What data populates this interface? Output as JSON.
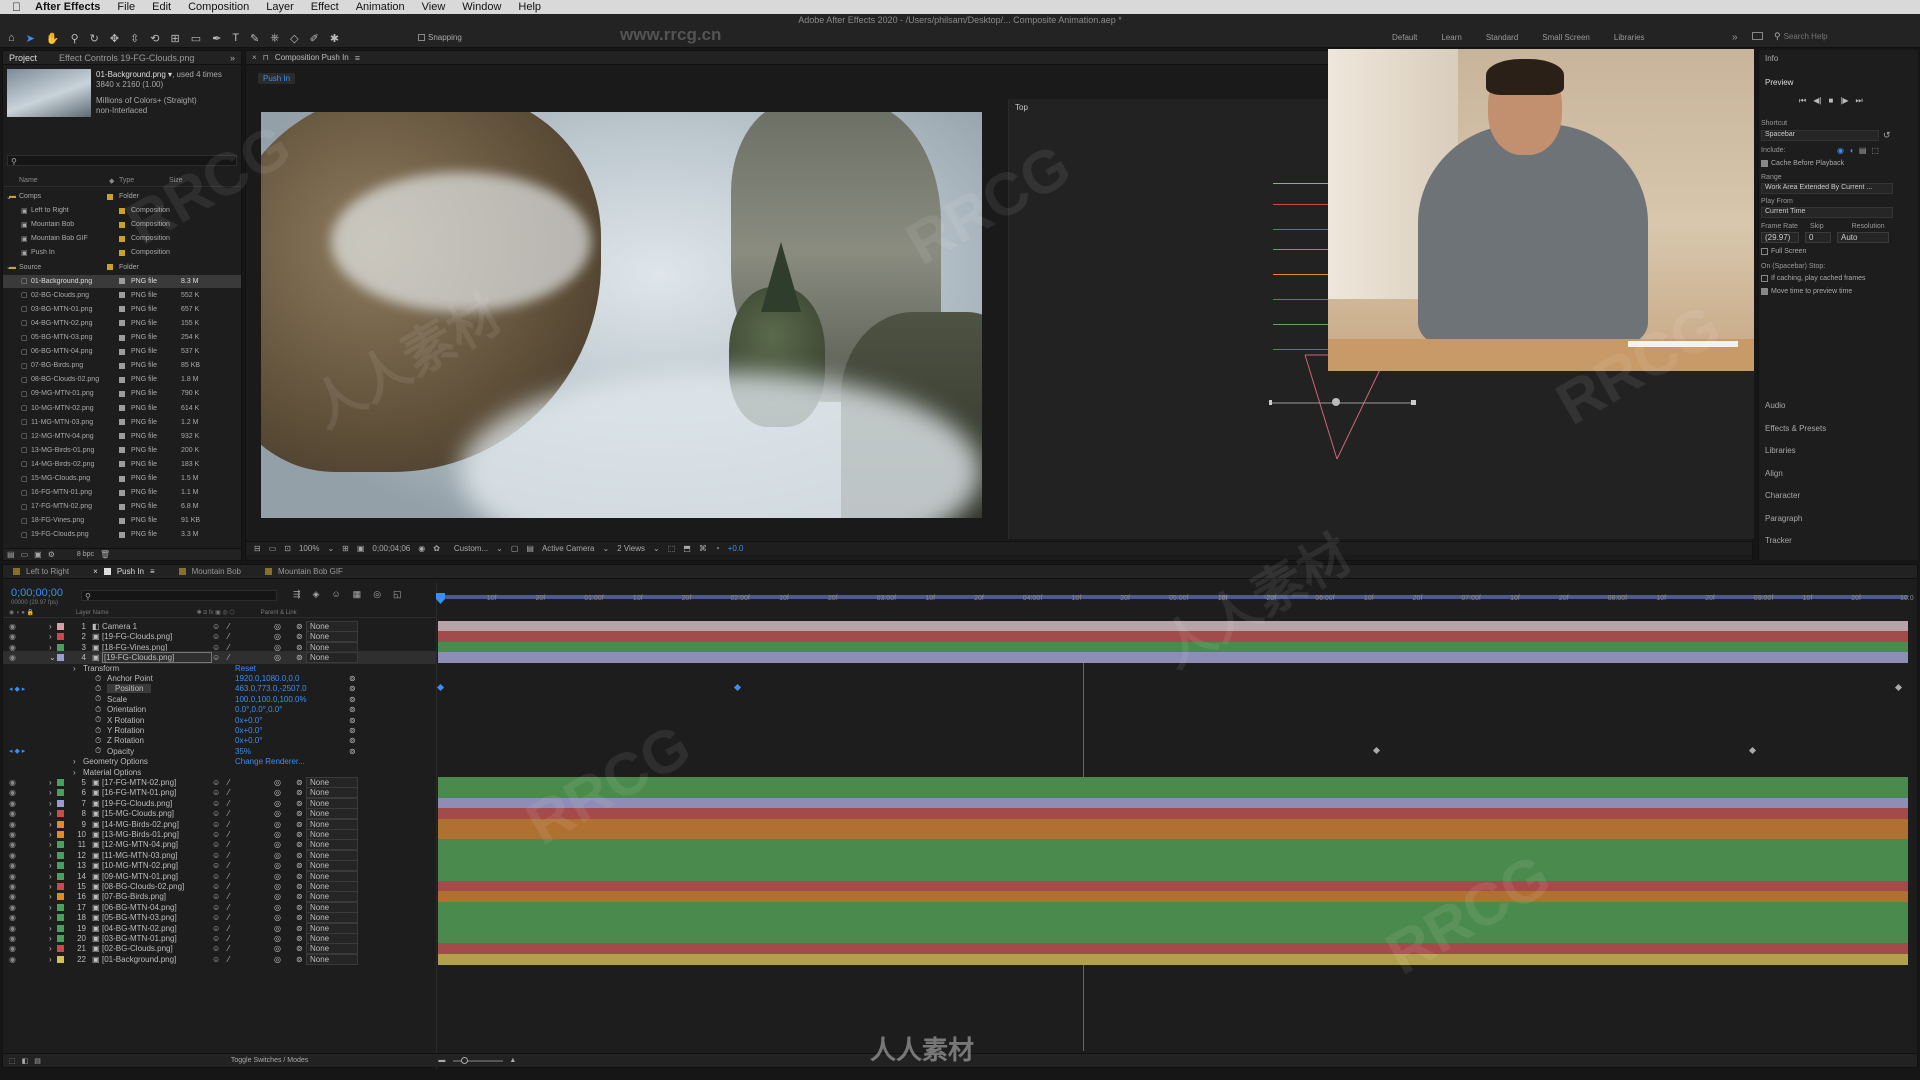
{
  "menubar": {
    "items": [
      "After Effects",
      "File",
      "Edit",
      "Composition",
      "Layer",
      "Effect",
      "Animation",
      "View",
      "Window",
      "Help"
    ]
  },
  "window": {
    "title": "Adobe After Effects 2020 - /Users/philsam/Desktop/... Composite Animation.aep *"
  },
  "toolbar": {
    "snapping": "Snapping",
    "workspaces": [
      "Default",
      "Learn",
      "Standard",
      "Small Screen",
      "Libraries"
    ],
    "search_placeholder": "Search Help",
    "url_watermark": "www.rrcg.cn"
  },
  "project": {
    "tab_project": "Project",
    "tab_effects": "Effect Controls 19-FG-Clouds.png",
    "asset_name": "01-Background.png ▾",
    "asset_used": ", used 4 times",
    "asset_dims": "3840 x 2160 (1.00)",
    "asset_colors": "Millions of Colors+ (Straight)",
    "asset_interlace": "non-Interlaced",
    "col_name": "Name",
    "col_type": "Type",
    "col_size": "Size",
    "bpc": "8 bpc",
    "items": [
      {
        "name": "Comps",
        "type": "Folder",
        "size": "",
        "indent": 0,
        "color": "#c9a227",
        "folder": true
      },
      {
        "name": "Left to Right",
        "type": "Composition",
        "size": "",
        "indent": 1,
        "color": "#c9a227"
      },
      {
        "name": "Mountain Bob",
        "type": "Composition",
        "size": "",
        "indent": 1,
        "color": "#c9a227"
      },
      {
        "name": "Mountain Bob GIF",
        "type": "Composition",
        "size": "",
        "indent": 1,
        "color": "#c9a227"
      },
      {
        "name": "Push In",
        "type": "Composition",
        "size": "",
        "indent": 1,
        "color": "#c9a227"
      },
      {
        "name": "Source",
        "type": "Folder",
        "size": "",
        "indent": 0,
        "color": "#c9a227",
        "folder": true
      },
      {
        "name": "01-Background.png",
        "type": "PNG file",
        "size": "8.3 M",
        "indent": 1,
        "color": "#9c9c9c",
        "sel": true
      },
      {
        "name": "02-BG-Clouds.png",
        "type": "PNG file",
        "size": "552 K",
        "indent": 1,
        "color": "#9c9c9c"
      },
      {
        "name": "03-BG-MTN-01.png",
        "type": "PNG file",
        "size": "657 K",
        "indent": 1,
        "color": "#9c9c9c"
      },
      {
        "name": "04-BG-MTN-02.png",
        "type": "PNG file",
        "size": "155 K",
        "indent": 1,
        "color": "#9c9c9c"
      },
      {
        "name": "05-BG-MTN-03.png",
        "type": "PNG file",
        "size": "254 K",
        "indent": 1,
        "color": "#9c9c9c"
      },
      {
        "name": "06-BG-MTN-04.png",
        "type": "PNG file",
        "size": "537 K",
        "indent": 1,
        "color": "#9c9c9c"
      },
      {
        "name": "07-BG-Birds.png",
        "type": "PNG file",
        "size": "85 KB",
        "indent": 1,
        "color": "#9c9c9c"
      },
      {
        "name": "08-BG-Clouds-02.png",
        "type": "PNG file",
        "size": "1.8 M",
        "indent": 1,
        "color": "#9c9c9c"
      },
      {
        "name": "09-MG-MTN-01.png",
        "type": "PNG file",
        "size": "790 K",
        "indent": 1,
        "color": "#9c9c9c"
      },
      {
        "name": "10-MG-MTN-02.png",
        "type": "PNG file",
        "size": "614 K",
        "indent": 1,
        "color": "#9c9c9c"
      },
      {
        "name": "11-MG-MTN-03.png",
        "type": "PNG file",
        "size": "1.2 M",
        "indent": 1,
        "color": "#9c9c9c"
      },
      {
        "name": "12-MG-MTN-04.png",
        "type": "PNG file",
        "size": "932 K",
        "indent": 1,
        "color": "#9c9c9c"
      },
      {
        "name": "13-MG-Birds-01.png",
        "type": "PNG file",
        "size": "200 K",
        "indent": 1,
        "color": "#9c9c9c"
      },
      {
        "name": "14-MG-Birds-02.png",
        "type": "PNG file",
        "size": "183 K",
        "indent": 1,
        "color": "#9c9c9c"
      },
      {
        "name": "15-MG-Clouds.png",
        "type": "PNG file",
        "size": "1.5 M",
        "indent": 1,
        "color": "#9c9c9c"
      },
      {
        "name": "16-FG-MTN-01.png",
        "type": "PNG file",
        "size": "1.1 M",
        "indent": 1,
        "color": "#9c9c9c"
      },
      {
        "name": "17-FG-MTN-02.png",
        "type": "PNG file",
        "size": "6.8 M",
        "indent": 1,
        "color": "#9c9c9c"
      },
      {
        "name": "18-FG-Vines.png",
        "type": "PNG file",
        "size": "91 KB",
        "indent": 1,
        "color": "#9c9c9c"
      },
      {
        "name": "19-FG-Clouds.png",
        "type": "PNG file",
        "size": "3.3 M",
        "indent": 1,
        "color": "#9c9c9c"
      }
    ]
  },
  "comp": {
    "tab": "Composition Push In",
    "subtab": "Push In",
    "top_label": "Top",
    "zoom": "100%",
    "time": "0;00;04;06",
    "res": "Custom...",
    "camera": "Active Camera",
    "views": "2 Views",
    "exposure": "+0.0"
  },
  "preview": {
    "info": "Info",
    "title": "Preview",
    "shortcut_label": "Shortcut",
    "shortcut_value": "Spacebar",
    "include_label": "Include:",
    "cache_before": "Cache Before Playback",
    "range_label": "Range",
    "range_value": "Work Area Extended By Current ...",
    "playfrom_label": "Play From",
    "playfrom_value": "Current Time",
    "framerate_label": "Frame Rate",
    "skip_label": "Skip",
    "resolution_label": "Resolution",
    "framerate_value": "(29.97)",
    "skip_value": "0",
    "resolution_value": "Auto",
    "fullscreen": "Full Screen",
    "stop_label": "On (Spacebar) Stop:",
    "if_caching": "If caching, play cached frames",
    "move_time": "Move time to preview time"
  },
  "side_panels": [
    "Audio",
    "Effects & Presets",
    "Libraries",
    "Align",
    "Character",
    "Paragraph",
    "Tracker"
  ],
  "timeline": {
    "tabs": [
      "Left to Right",
      "Push In",
      "Mountain Bob",
      "Mountain Bob GIF"
    ],
    "active_tab": 1,
    "timecode": "0;00;00;00",
    "fps": "00000 (29.97 fps)",
    "col_layer": "Layer Name",
    "col_parent": "Parent & Link",
    "toggle": "Toggle Switches / Modes",
    "ruler": [
      "0f",
      "10f",
      "20f",
      "01:00f",
      "10f",
      "20f",
      "02:00f",
      "10f",
      "20f",
      "03:00f",
      "10f",
      "20f",
      "04:00f",
      "10f",
      "20f",
      "05:00f",
      "10f",
      "20f",
      "06:00f",
      "10f",
      "20f",
      "07:00f",
      "10f",
      "20f",
      "08:00f",
      "10f",
      "20f",
      "09:00f",
      "10f",
      "20f",
      "10:0"
    ],
    "layers_top": [
      {
        "num": "1",
        "name": "Camera 1",
        "color": "#d6a0a6",
        "bar": "#b7a3a8",
        "cam": true
      },
      {
        "num": "2",
        "name": "[19-FG-Clouds.png]",
        "color": "#c94b4b",
        "bar": "#a34a4a"
      },
      {
        "num": "3",
        "name": "[18-FG-Vines.png]",
        "color": "#4aa05a",
        "bar": "#4b8a4d"
      },
      {
        "num": "4",
        "name": "[19-FG-Clouds.png]",
        "color": "#9b9bcf",
        "bar": "#8d8db5",
        "sel": true
      }
    ],
    "props": [
      {
        "name": "Transform",
        "value": "Reset",
        "indent": 1
      },
      {
        "name": "Anchor Point",
        "value": "1920.0,1080.0,0.0",
        "indent": 2
      },
      {
        "name": "Position",
        "value": "463.0,773.0,-2507.0",
        "indent": 2,
        "key": true
      },
      {
        "name": "Scale",
        "value": "100.0,100.0,100.0%",
        "indent": 2
      },
      {
        "name": "Orientation",
        "value": "0.0°,0.0°,0.0°",
        "indent": 2
      },
      {
        "name": "X Rotation",
        "value": "0x+0.0°",
        "indent": 2
      },
      {
        "name": "Y Rotation",
        "value": "0x+0.0°",
        "indent": 2
      },
      {
        "name": "Z Rotation",
        "value": "0x+0.0°",
        "indent": 2
      },
      {
        "name": "Opacity",
        "value": "35%",
        "indent": 2,
        "key": true
      },
      {
        "name": "Geometry Options",
        "value": "Change Renderer...",
        "indent": 1
      },
      {
        "name": "Material Options",
        "value": "",
        "indent": 1
      }
    ],
    "layers_bottom": [
      {
        "num": "5",
        "name": "[17-FG-MTN-02.png]",
        "color": "#4aa05a",
        "bar": "#4b8a4d"
      },
      {
        "num": "6",
        "name": "[16-FG-MTN-01.png]",
        "color": "#4aa05a",
        "bar": "#4b8a4d"
      },
      {
        "num": "7",
        "name": "[19-FG-Clouds.png]",
        "color": "#9b9bcf",
        "bar": "#8d8db5"
      },
      {
        "num": "8",
        "name": "[15-MG-Clouds.png]",
        "color": "#c94b4b",
        "bar": "#a34a4a"
      },
      {
        "num": "9",
        "name": "[14-MG-Birds-02.png]",
        "color": "#e08a2a",
        "bar": "#b07030"
      },
      {
        "num": "10",
        "name": "[13-MG-Birds-01.png]",
        "color": "#e08a2a",
        "bar": "#b07030"
      },
      {
        "num": "11",
        "name": "[12-MG-MTN-04.png]",
        "color": "#4aa05a",
        "bar": "#4b8a4d"
      },
      {
        "num": "12",
        "name": "[11-MG-MTN-03.png]",
        "color": "#4aa05a",
        "bar": "#4b8a4d"
      },
      {
        "num": "13",
        "name": "[10-MG-MTN-02.png]",
        "color": "#4aa05a",
        "bar": "#4b8a4d"
      },
      {
        "num": "14",
        "name": "[09-MG-MTN-01.png]",
        "color": "#4aa05a",
        "bar": "#4b8a4d"
      },
      {
        "num": "15",
        "name": "[08-BG-Clouds-02.png]",
        "color": "#c94b4b",
        "bar": "#a34a4a"
      },
      {
        "num": "16",
        "name": "[07-BG-Birds.png]",
        "color": "#e08a2a",
        "bar": "#b07030"
      },
      {
        "num": "17",
        "name": "[06-BG-MTN-04.png]",
        "color": "#4aa05a",
        "bar": "#4b8a4d"
      },
      {
        "num": "18",
        "name": "[05-BG-MTN-03.png]",
        "color": "#4aa05a",
        "bar": "#4b8a4d"
      },
      {
        "num": "19",
        "name": "[04-BG-MTN-02.png]",
        "color": "#4aa05a",
        "bar": "#4b8a4d"
      },
      {
        "num": "20",
        "name": "[03-BG-MTN-01.png]",
        "color": "#4aa05a",
        "bar": "#4b8a4d"
      },
      {
        "num": "21",
        "name": "[02-BG-Clouds.png]",
        "color": "#c94b4b",
        "bar": "#a34a4a"
      },
      {
        "num": "22",
        "name": "[01-Background.png]",
        "color": "#d8c24a",
        "bar": "#b1a14c"
      }
    ],
    "parent_none": "None"
  },
  "watermark": {
    "text": "RRCG",
    "cn": "人人素材"
  }
}
